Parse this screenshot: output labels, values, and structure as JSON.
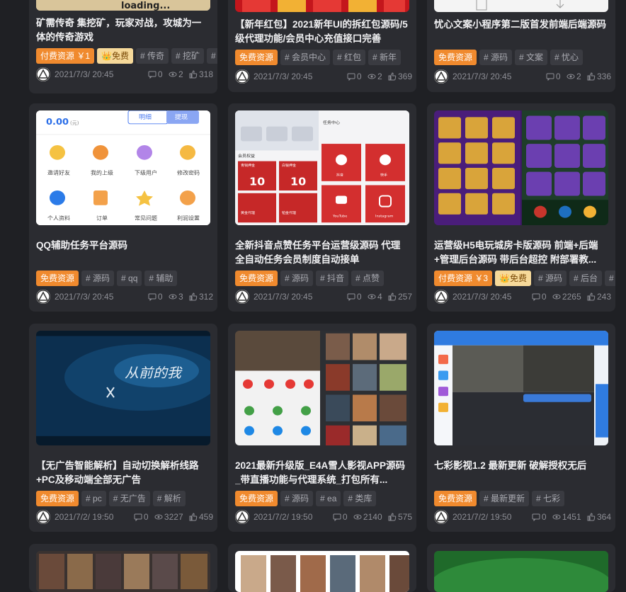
{
  "cards": [
    {
      "title": "矿需传奇 集挖矿，玩家对战，攻城为一体的传奇游戏",
      "tags": [
        {
          "text": "付费资源 ￥1",
          "style": "orange"
        },
        {
          "text": "免费",
          "style": "vip"
        },
        {
          "text": "# 传奇",
          "style": "gray"
        },
        {
          "text": "# 挖矿",
          "style": "gray"
        },
        {
          "text": "#",
          "style": "gray"
        }
      ],
      "date": "2021/7/3/ 20:45",
      "comments": "0",
      "views": "2",
      "likes": "318"
    },
    {
      "title": "【新年红包】2021新年UI的拆红包源码/5级代理功能/会员中心充值接口完善",
      "tags": [
        {
          "text": "免费资源",
          "style": "orange"
        },
        {
          "text": "# 会员中心",
          "style": "gray"
        },
        {
          "text": "# 红包",
          "style": "gray"
        },
        {
          "text": "# 新年",
          "style": "gray"
        }
      ],
      "date": "2021/7/3/ 20:45",
      "comments": "0",
      "views": "2",
      "likes": "369"
    },
    {
      "title": "忧心文案小程序第二版首发前端后端源码",
      "tags": [
        {
          "text": "免费资源",
          "style": "orange"
        },
        {
          "text": "# 源码",
          "style": "gray"
        },
        {
          "text": "# 文案",
          "style": "gray"
        },
        {
          "text": "# 忧心",
          "style": "gray"
        }
      ],
      "date": "2021/7/3/ 20:45",
      "comments": "0",
      "views": "2",
      "likes": "336"
    },
    {
      "title": "QQ辅助任务平台源码",
      "tags": [
        {
          "text": "免费资源",
          "style": "orange"
        },
        {
          "text": "# 源码",
          "style": "gray"
        },
        {
          "text": "# qq",
          "style": "gray"
        },
        {
          "text": "# 辅助",
          "style": "gray"
        }
      ],
      "date": "2021/7/3/ 20:45",
      "comments": "0",
      "views": "3",
      "likes": "312"
    },
    {
      "title": "全新抖音点赞任务平台运营级源码 代理全自动任务会员制度自动接单",
      "tags": [
        {
          "text": "免费资源",
          "style": "orange"
        },
        {
          "text": "# 源码",
          "style": "gray"
        },
        {
          "text": "# 抖音",
          "style": "gray"
        },
        {
          "text": "# 点赞",
          "style": "gray"
        }
      ],
      "date": "2021/7/3/ 20:45",
      "comments": "0",
      "views": "4",
      "likes": "257"
    },
    {
      "title": "运营级H5电玩城房卡版源码 前端+后端+管理后台源码 带后台超控 附部署教...",
      "tags": [
        {
          "text": "付费资源 ￥3",
          "style": "orange"
        },
        {
          "text": "免费",
          "style": "vip"
        },
        {
          "text": "# 源码",
          "style": "gray"
        },
        {
          "text": "# 后台",
          "style": "gray"
        },
        {
          "text": "#",
          "style": "gray"
        }
      ],
      "date": "2021/7/3/ 20:45",
      "comments": "0",
      "views": "2265",
      "likes": "243"
    },
    {
      "title": "【无广告智能解析】自动切换解析线路+PC及移动端全部无广告",
      "tags": [
        {
          "text": "免费资源",
          "style": "orange"
        },
        {
          "text": "# pc",
          "style": "gray"
        },
        {
          "text": "# 无广告",
          "style": "gray"
        },
        {
          "text": "# 解析",
          "style": "gray"
        }
      ],
      "date": "2021/7/2/ 19:50",
      "comments": "0",
      "views": "3227",
      "likes": "459"
    },
    {
      "title": "2021最新升级版_E4A雪人影视APP源码_带直播功能与代理系统_打包所有...",
      "tags": [
        {
          "text": "免费资源",
          "style": "orange"
        },
        {
          "text": "# 源码",
          "style": "gray"
        },
        {
          "text": "# ea",
          "style": "gray"
        },
        {
          "text": "# 类库",
          "style": "gray"
        }
      ],
      "date": "2021/7/2/ 19:50",
      "comments": "0",
      "views": "2140",
      "likes": "575"
    },
    {
      "title": "七彩影视1.2 最新更新 破解授权无后",
      "tags": [
        {
          "text": "免费资源",
          "style": "orange"
        },
        {
          "text": "# 最新更新",
          "style": "gray"
        },
        {
          "text": "# 七彩",
          "style": "gray"
        }
      ],
      "date": "2021/7/2/ 19:50",
      "comments": "0",
      "views": "1451",
      "likes": "364"
    }
  ],
  "thumb_text": {
    "c1_loading": "loading...",
    "c4_balance": "0.00",
    "c4_unit": "(元)",
    "c4_btn1": "明细",
    "c4_btn2": "提现",
    "c4_labels": [
      "邀请好友",
      "我的上级",
      "下级用户",
      "修改密码",
      "个人资料",
      "订单",
      "常见问题",
      "利润设置"
    ],
    "c5_section1": "会员权益",
    "c5_section2": "任务中心",
    "c5_boxes": [
      "10",
      "10"
    ],
    "c5_box_labels": [
      "青铜押金",
      "白银押金",
      "黄金代理",
      "铂金代理"
    ],
    "c5_icon_labels": [
      "抖音",
      "快手",
      "YouTube",
      "Instagram"
    ],
    "c7_poster": "从前的我"
  },
  "colors": {
    "accent": "#f08a2e",
    "card": "#2b2c31",
    "bg": "#1f2024"
  }
}
